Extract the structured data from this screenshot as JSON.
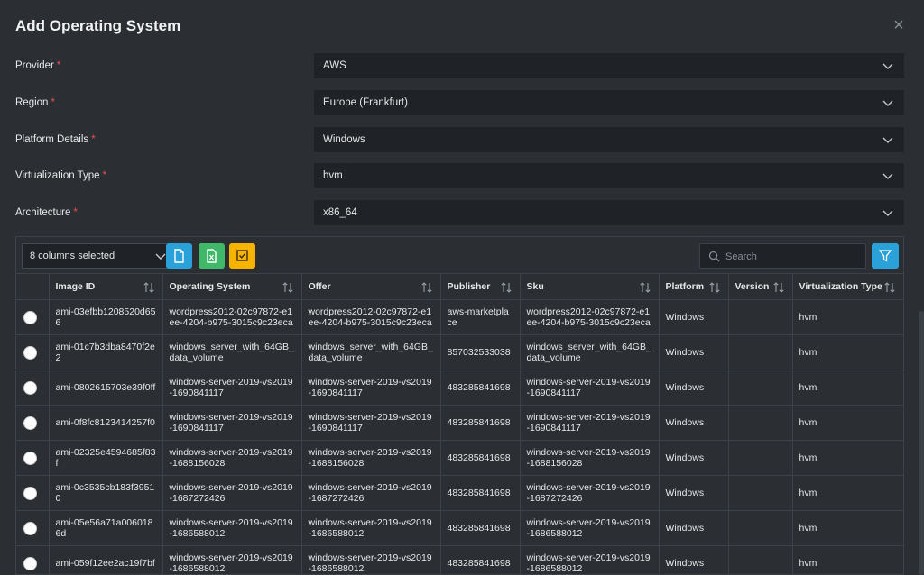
{
  "dialog": {
    "title": "Add Operating System",
    "close_symbol": "×"
  },
  "form": {
    "required_marker": "*",
    "fields": [
      {
        "label": "Provider",
        "value": "AWS"
      },
      {
        "label": "Region",
        "value": "Europe (Frankfurt)"
      },
      {
        "label": "Platform Details",
        "value": "Windows"
      },
      {
        "label": "Virtualization Type",
        "value": "hvm"
      },
      {
        "label": "Architecture",
        "value": "x86_64"
      }
    ]
  },
  "toolbar": {
    "columns_selected": "8 columns selected",
    "search_placeholder": "Search",
    "button_colors": {
      "export": "#2aa1d8",
      "excel": "#3fb86a",
      "select": "#f5b400",
      "filter": "#2aa1d8"
    }
  },
  "table": {
    "columns": [
      "",
      "Image ID",
      "Operating System",
      "Offer",
      "Publisher",
      "Sku",
      "Platform",
      "Version",
      "Virtualization Type"
    ],
    "rows": [
      [
        "ami-03efbb1208520d656",
        "wordpress2012-02c97872-e1ee-4204-b975-3015c9c23eca",
        "wordpress2012-02c97872-e1ee-4204-b975-3015c9c23eca",
        "aws-marketplace",
        "wordpress2012-02c97872-e1ee-4204-b975-3015c9c23eca",
        "Windows",
        "",
        "hvm"
      ],
      [
        "ami-01c7b3dba8470f2e2",
        "windows_server_with_64GB_data_volume",
        "windows_server_with_64GB_data_volume",
        "857032533038",
        "windows_server_with_64GB_data_volume",
        "Windows",
        "",
        "hvm"
      ],
      [
        "ami-0802615703e39f0ff",
        "windows-server-2019-vs2019-1690841117",
        "windows-server-2019-vs2019-1690841117",
        "483285841698",
        "windows-server-2019-vs2019-1690841117",
        "Windows",
        "",
        "hvm"
      ],
      [
        "ami-0f8fc8123414257f0",
        "windows-server-2019-vs2019-1690841117",
        "windows-server-2019-vs2019-1690841117",
        "483285841698",
        "windows-server-2019-vs2019-1690841117",
        "Windows",
        "",
        "hvm"
      ],
      [
        "ami-02325e4594685f83f",
        "windows-server-2019-vs2019-1688156028",
        "windows-server-2019-vs2019-1688156028",
        "483285841698",
        "windows-server-2019-vs2019-1688156028",
        "Windows",
        "",
        "hvm"
      ],
      [
        "ami-0c3535cb183f39510",
        "windows-server-2019-vs2019-1687272426",
        "windows-server-2019-vs2019-1687272426",
        "483285841698",
        "windows-server-2019-vs2019-1687272426",
        "Windows",
        "",
        "hvm"
      ],
      [
        "ami-05e56a71a0060186d",
        "windows-server-2019-vs2019-1686588012",
        "windows-server-2019-vs2019-1686588012",
        "483285841698",
        "windows-server-2019-vs2019-1686588012",
        "Windows",
        "",
        "hvm"
      ],
      [
        "ami-059f12ee2ac19f7bf",
        "windows-server-2019-vs2019-1686588012",
        "windows-server-2019-vs2019-1686588012",
        "483285841698",
        "windows-server-2019-vs2019-1686588012",
        "Windows",
        "",
        "hvm"
      ]
    ]
  }
}
